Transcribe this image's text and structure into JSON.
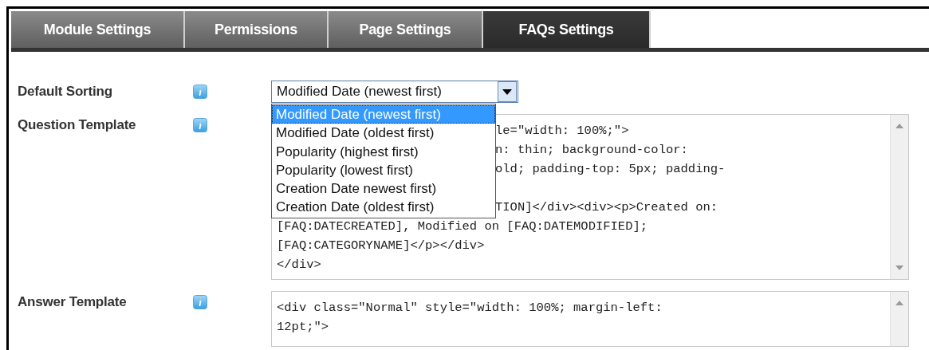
{
  "tabs": [
    {
      "label": "Module Settings",
      "selected": false
    },
    {
      "label": "Permissions",
      "selected": false
    },
    {
      "label": "Page Settings",
      "selected": false
    },
    {
      "label": "FAQs Settings",
      "selected": true
    }
  ],
  "fields": [
    {
      "kind": "select",
      "label": "Default Sorting",
      "value": "Modified Date (newest first)",
      "expanded": true,
      "options": [
        {
          "label": "Modified Date (newest first)",
          "selected": true
        },
        {
          "label": "Modified Date (oldest first)",
          "selected": false
        },
        {
          "label": "Popularity (highest first)",
          "selected": false
        },
        {
          "label": "Popularity (lowest first)",
          "selected": false
        },
        {
          "label": "Creation Date newest first)",
          "selected": false
        },
        {
          "label": "Creation Date (oldest first)",
          "selected": false
        }
      ]
    },
    {
      "kind": "textarea",
      "label": "Question Template",
      "lines": [
        {
          "text": "le=\"width: 100%;\">"
        },
        {
          "text": "n: thin; background-color:"
        },
        {
          "text": "old; padding-top: 5px; padding-"
        },
        {
          "text": "TION]</div><div><p>Created on:",
          "blank_line_before": true
        },
        {
          "text": "[FAQ:DATECREATED], Modified on [FAQ:DATEMODIFIED];"
        },
        {
          "text": "[FAQ:CATEGORYNAME]</p></div>"
        },
        {
          "text": "</div>"
        }
      ]
    },
    {
      "kind": "textarea",
      "label": "Answer Template",
      "lines": [
        {
          "text": "<div class=\"Normal\" style=\"width: 100%; margin-left:"
        },
        {
          "text": "12pt;\">"
        }
      ]
    }
  ]
}
